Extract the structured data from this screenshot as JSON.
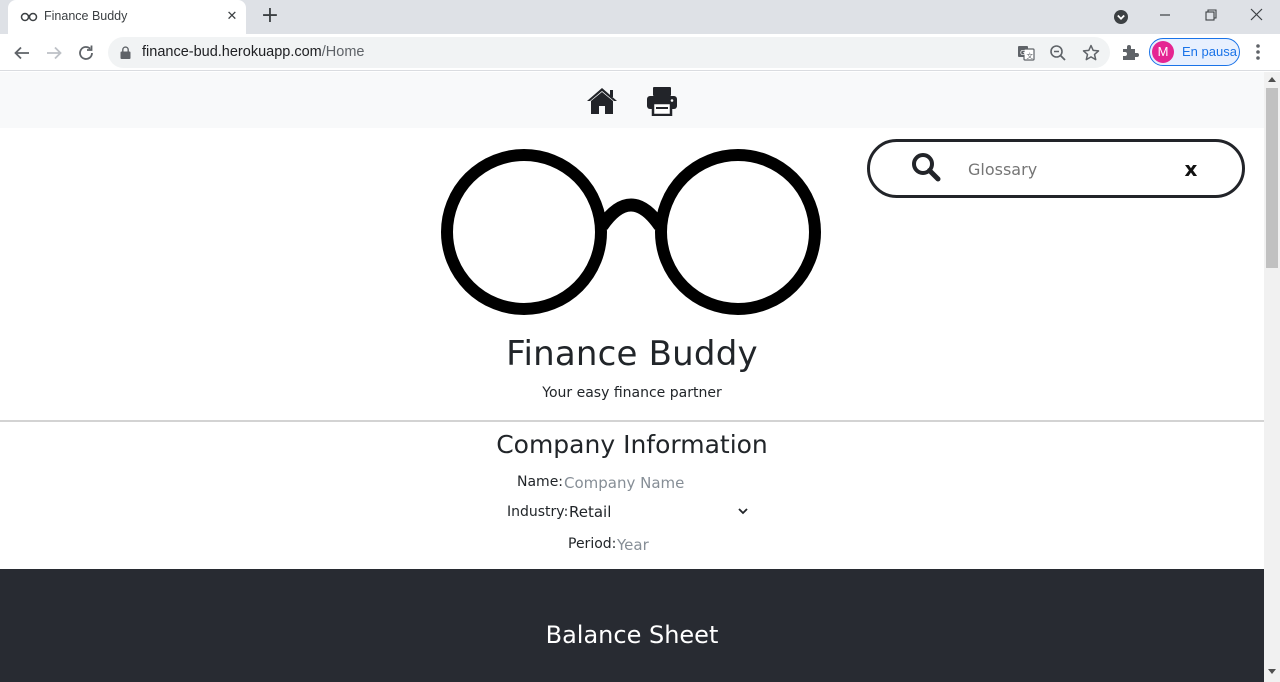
{
  "browser": {
    "tab_title": "Finance Buddy",
    "url_host": "finance-bud.herokuapp.com",
    "url_path": "/Home",
    "profile_initial": "M",
    "profile_label": "En pausa"
  },
  "page": {
    "nav": {
      "home_icon": "home-icon",
      "print_icon": "print-icon"
    },
    "search": {
      "placeholder": "Glossary",
      "clear_label": "x"
    },
    "hero": {
      "title": "Finance Buddy",
      "subtitle": "Your easy finance partner"
    },
    "company_info": {
      "title": "Company Information",
      "name_label": "Name:",
      "name_placeholder": "Company Name",
      "industry_label": "Industry:",
      "industry_value": "Retail",
      "period_label": "Period:",
      "period_placeholder": "Year"
    },
    "balance_sheet": {
      "title": "Balance Sheet"
    }
  },
  "colors": {
    "dark_section": "#282b32",
    "nav_background": "#f8f9fa",
    "profile_accent": "#1a73e8",
    "avatar": "#e52592"
  }
}
